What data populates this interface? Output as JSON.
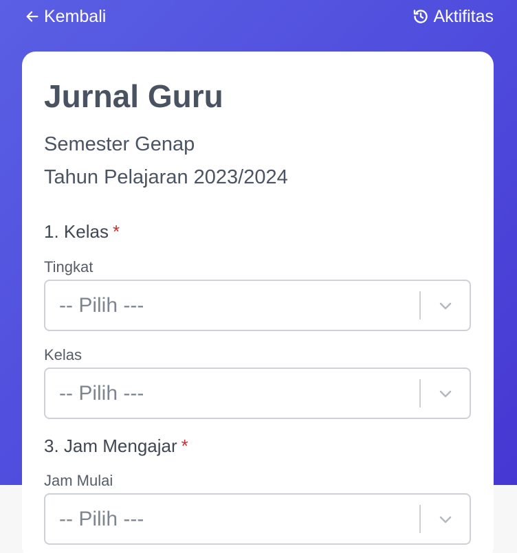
{
  "nav": {
    "back_label": "Kembali",
    "activity_label": "Aktifitas"
  },
  "form": {
    "title": "Jurnal Guru",
    "semester": "Semester Genap",
    "academic_year": "Tahun Pelajaran 2023/2024",
    "section_class": {
      "label": "1. Kelas",
      "required_mark": "*"
    },
    "field_grade": {
      "label": "Tingkat",
      "value": "-- Pilih ---"
    },
    "field_class": {
      "label": "Kelas",
      "value": "-- Pilih ---"
    },
    "section_hours": {
      "label": "3. Jam Mengajar",
      "required_mark": "*"
    },
    "field_start": {
      "label": "Jam Mulai",
      "value": "-- Pilih ---"
    }
  },
  "icons": {
    "back": "arrow-left-icon",
    "activity": "history-icon",
    "dropdown": "chevron-down-icon"
  },
  "colors": {
    "header_gradient_start": "#5a5fe4",
    "header_gradient_end": "#4637d2",
    "required": "#c53030",
    "title_text": "#495260"
  }
}
